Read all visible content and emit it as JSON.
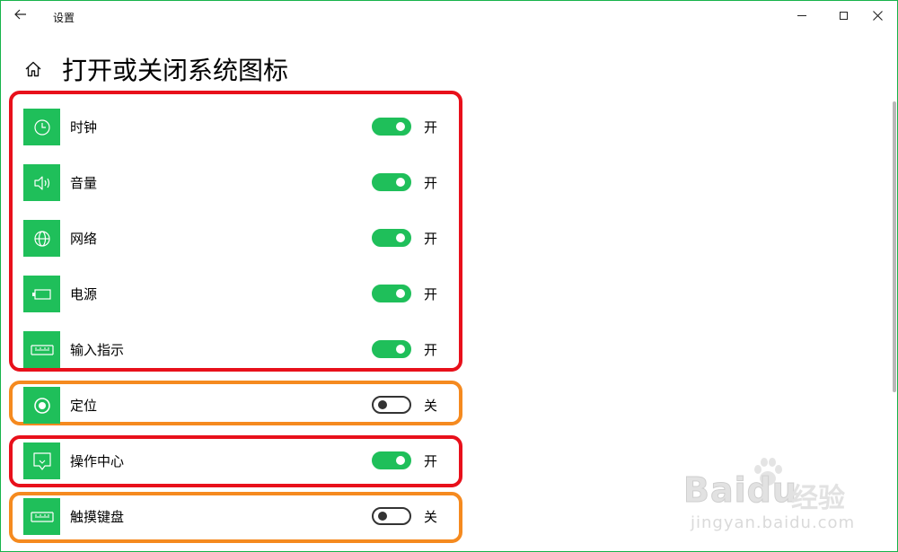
{
  "window": {
    "title": "设置",
    "back_icon": "back-arrow-icon",
    "controls": [
      "minimize-icon",
      "maximize-icon",
      "close-icon"
    ]
  },
  "page": {
    "title": "打开或关闭系统图标",
    "home_icon": "home-icon"
  },
  "items": [
    {
      "label": "时钟",
      "state": "开",
      "on": true,
      "icon": "clock-icon"
    },
    {
      "label": "音量",
      "state": "开",
      "on": true,
      "icon": "volume-icon"
    },
    {
      "label": "网络",
      "state": "开",
      "on": true,
      "icon": "network-globe-icon"
    },
    {
      "label": "电源",
      "state": "开",
      "on": true,
      "icon": "power-battery-icon"
    },
    {
      "label": "输入指示",
      "state": "开",
      "on": true,
      "icon": "keyboard-icon"
    },
    {
      "label": "定位",
      "state": "关",
      "on": false,
      "icon": "location-icon"
    },
    {
      "label": "操作中心",
      "state": "开",
      "on": true,
      "icon": "action-center-icon"
    },
    {
      "label": "触摸键盘",
      "state": "关",
      "on": false,
      "icon": "touch-keyboard-icon"
    }
  ],
  "colors": {
    "accent": "#1fbf5a",
    "highlight_red": "#e8101b",
    "highlight_orange": "#f58a1f"
  },
  "watermark": {
    "brand": "Bai",
    "brand_suffix": "du",
    "cn": "经验",
    "url": "jingyan.baidu.com"
  }
}
